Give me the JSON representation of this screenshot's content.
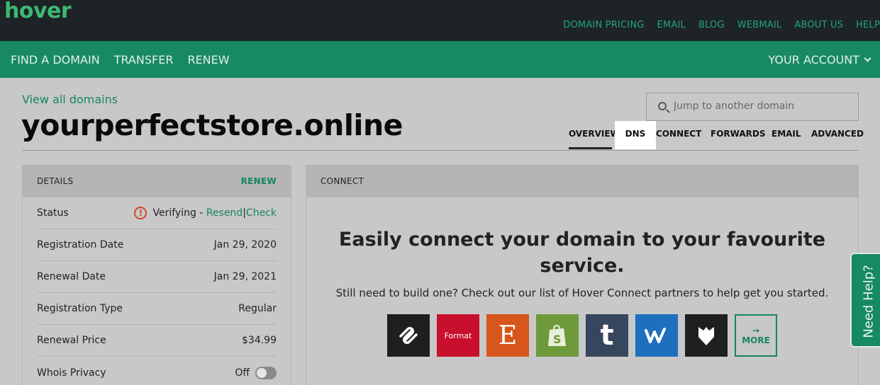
{
  "brand": {
    "logo": "hover"
  },
  "top_links": [
    "DOMAIN PRICING",
    "EMAIL",
    "BLOG",
    "WEBMAIL",
    "ABOUT US",
    "HELP"
  ],
  "nav": {
    "items": [
      "FIND A DOMAIN",
      "TRANSFER",
      "RENEW"
    ],
    "account": "YOUR ACCOUNT"
  },
  "header": {
    "view_all": "View all domains",
    "domain": "yourperfectstore.online",
    "search_placeholder": "Jump to another domain"
  },
  "tabs": [
    "OVERVIEW",
    "DNS",
    "CONNECT",
    "FORWARDS",
    "EMAIL",
    "ADVANCED"
  ],
  "active_tab": "OVERVIEW",
  "details": {
    "title": "DETAILS",
    "renew_label": "RENEW",
    "status_label": "Status",
    "status_text": "Verifying -",
    "resend": "Resend",
    "separator": "|",
    "check": "Check",
    "rows": [
      {
        "label": "Registration Date",
        "value": "Jan 29, 2020"
      },
      {
        "label": "Renewal Date",
        "value": "Jan 29, 2021"
      },
      {
        "label": "Registration Type",
        "value": "Regular"
      },
      {
        "label": "Renewal Price",
        "value": "$34.99"
      }
    ],
    "whois_label": "Whois Privacy",
    "whois_value": "Off"
  },
  "connect": {
    "title": "CONNECT",
    "headline": "Easily connect your domain to your favourite service.",
    "subtext": "Still need to build one? Check out our list of Hover Connect partners to help get you started.",
    "partners": [
      {
        "name": "squarespace-logo",
        "bg": "#1f1f1f"
      },
      {
        "name": "format-logo",
        "bg": "#c8102e",
        "text": "Format"
      },
      {
        "name": "etsy-logo",
        "bg": "#d7561c",
        "text": "E"
      },
      {
        "name": "shopify-logo",
        "bg": "#6f9a3c"
      },
      {
        "name": "tumblr-logo",
        "bg": "#36465d",
        "text": "t"
      },
      {
        "name": "weebly-logo",
        "bg": "#1f6fbf"
      },
      {
        "name": "bigcartel-logo",
        "bg": "#1f1f1f"
      }
    ],
    "more_arrow": "→",
    "more": "MORE"
  },
  "help": {
    "label": "Need Help?"
  },
  "colors": {
    "accent": "#178a62",
    "topbar": "#1e2327",
    "warning": "#d0492a"
  }
}
